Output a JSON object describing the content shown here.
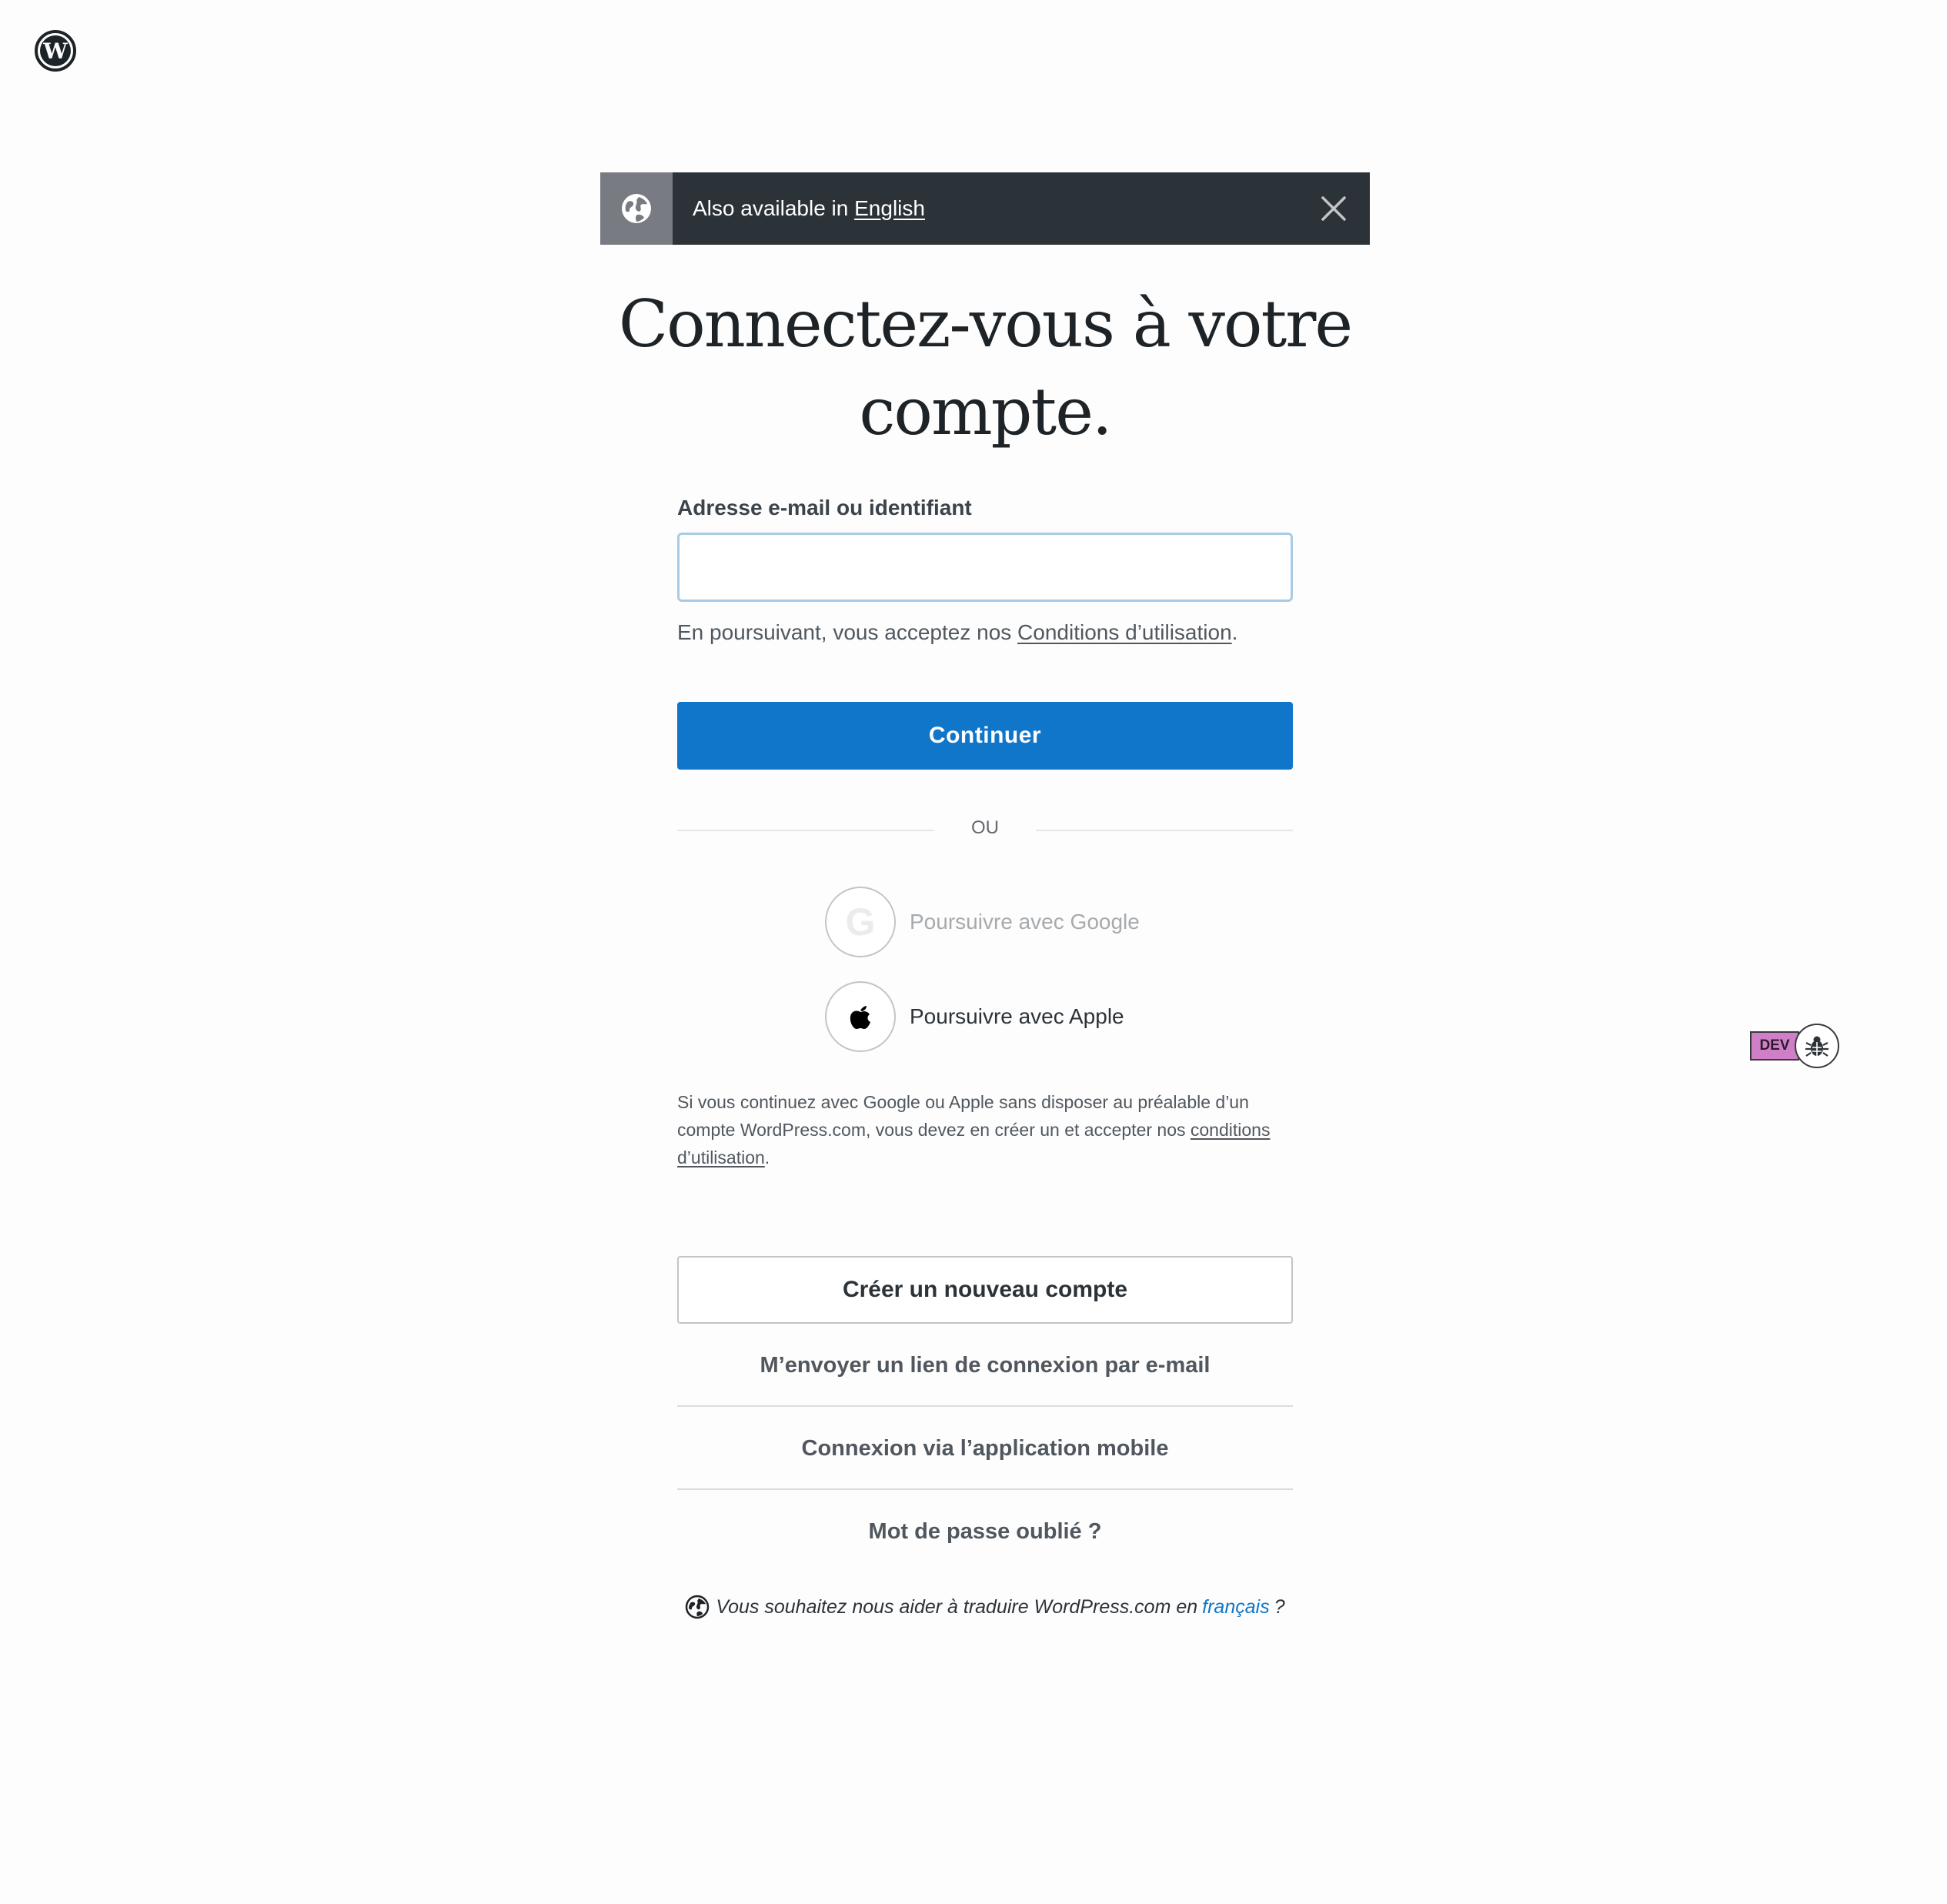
{
  "locale_banner": {
    "text": "Also available in",
    "link": "English"
  },
  "title": "Connectez-vous à votre compte.",
  "login_form": {
    "email_label": "Adresse e-mail ou identifiant",
    "email_value": "",
    "tos_prefix": "En poursuivant, vous acceptez nos",
    "tos_link": "Conditions d’utilisation",
    "tos_suffix": ".",
    "continue_label": "Continuer"
  },
  "divider": {
    "label": "OU"
  },
  "social": {
    "google_label": "Poursuivre avec Google",
    "apple_label": "Poursuivre avec Apple",
    "note_text": "Si vous continuez avec Google ou Apple sans disposer au préalable d’un compte WordPress.com, vous devez en créer un et accepter nos",
    "note_link": "conditions d’utilisation",
    "note_suffix": "."
  },
  "actions": {
    "create_account": "Créer un nouveau compte",
    "email_link": "M’envoyer un lien de connexion par e-mail",
    "mobile_app": "Connexion via l’application mobile",
    "forgot_password": "Mot de passe oublié ?"
  },
  "translate": {
    "text": "Vous souhaitez nous aider à traduire WordPress.com en",
    "link": "français",
    "suffix": "?"
  },
  "dev_widget": {
    "badge": "DEV"
  },
  "colors": {
    "primary": "#1076c9",
    "banner": "#2c3338",
    "dev_badge": "#cf7fc7"
  },
  "icons": [
    "wordpress-logo",
    "globe-icon",
    "close-icon",
    "google-icon",
    "apple-icon",
    "bug-icon"
  ]
}
